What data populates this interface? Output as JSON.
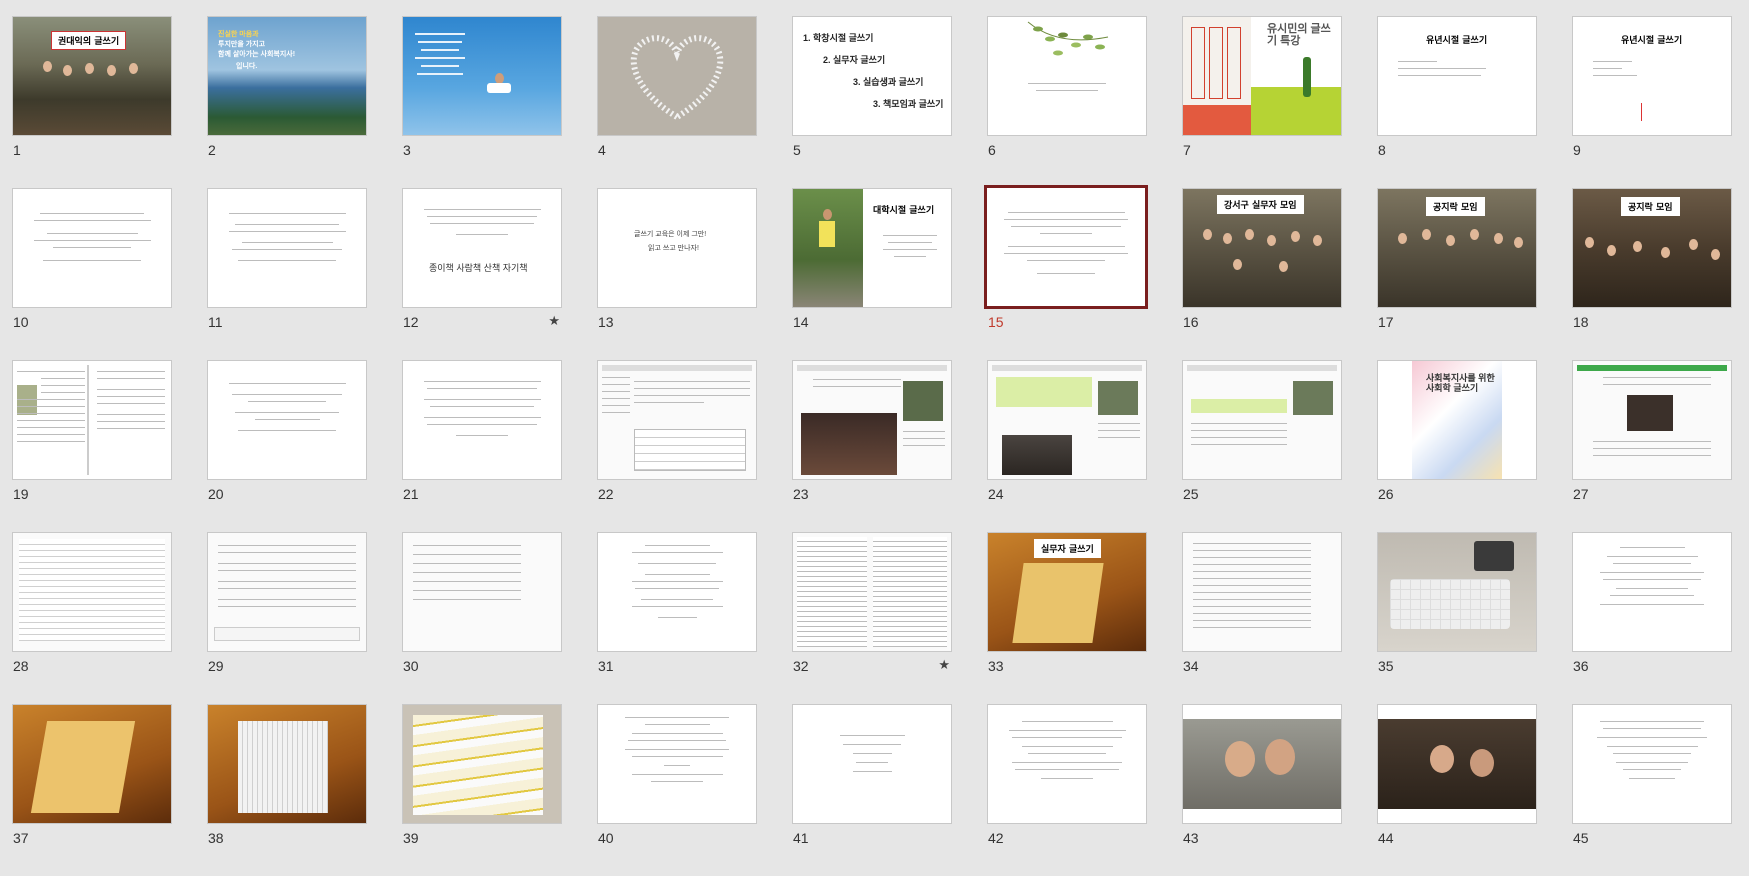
{
  "selected_slide": "15",
  "slides": [
    {
      "n": "1",
      "caption": "권대익의 글쓰기"
    },
    {
      "n": "2",
      "caption": "",
      "lines": [
        "진실한 마음과",
        "투지만을 가지고",
        "함께 살아가는 사회복지사!",
        "입니다."
      ]
    },
    {
      "n": "3",
      "caption": ""
    },
    {
      "n": "4",
      "caption": ""
    },
    {
      "n": "5",
      "caption": "",
      "list": [
        "1. 학창시절 글쓰기",
        "2. 실무자 글쓰기",
        "3. 실습생과 글쓰기",
        "3. 책모임과 글쓰기"
      ]
    },
    {
      "n": "6",
      "caption": ""
    },
    {
      "n": "7",
      "caption": "유시민의 글쓰기 특강"
    },
    {
      "n": "8",
      "caption": "유년시절 글쓰기"
    },
    {
      "n": "9",
      "caption": "유년시절 글쓰기"
    },
    {
      "n": "10",
      "caption": ""
    },
    {
      "n": "11",
      "caption": ""
    },
    {
      "n": "12",
      "caption": "종이책 사람책 산책 자기책",
      "star": "★"
    },
    {
      "n": "13",
      "caption": "",
      "lines": [
        "글쓰기 교육은 이제 그만!",
        "읽고 쓰고 만나자!"
      ]
    },
    {
      "n": "14",
      "caption": "대학시절 글쓰기"
    },
    {
      "n": "15",
      "caption": ""
    },
    {
      "n": "16",
      "caption": "강서구 실무자 모임"
    },
    {
      "n": "17",
      "caption": "공지락 모임"
    },
    {
      "n": "18",
      "caption": "공지락 모임"
    },
    {
      "n": "19",
      "caption": ""
    },
    {
      "n": "20",
      "caption": ""
    },
    {
      "n": "21",
      "caption": ""
    },
    {
      "n": "22",
      "caption": ""
    },
    {
      "n": "23",
      "caption": ""
    },
    {
      "n": "24",
      "caption": ""
    },
    {
      "n": "25",
      "caption": ""
    },
    {
      "n": "26",
      "caption": "사회복지사를 위한 사회학 글쓰기"
    },
    {
      "n": "27",
      "caption": ""
    },
    {
      "n": "28",
      "caption": ""
    },
    {
      "n": "29",
      "caption": ""
    },
    {
      "n": "30",
      "caption": ""
    },
    {
      "n": "31",
      "caption": ""
    },
    {
      "n": "32",
      "caption": "",
      "star": "★"
    },
    {
      "n": "33",
      "caption": "실무자 글쓰기"
    },
    {
      "n": "34",
      "caption": ""
    },
    {
      "n": "35",
      "caption": ""
    },
    {
      "n": "36",
      "caption": ""
    },
    {
      "n": "37",
      "caption": ""
    },
    {
      "n": "38",
      "caption": ""
    },
    {
      "n": "39",
      "caption": ""
    },
    {
      "n": "40",
      "caption": ""
    },
    {
      "n": "41",
      "caption": ""
    },
    {
      "n": "42",
      "caption": ""
    },
    {
      "n": "43",
      "caption": ""
    },
    {
      "n": "44",
      "caption": ""
    },
    {
      "n": "45",
      "caption": ""
    }
  ]
}
